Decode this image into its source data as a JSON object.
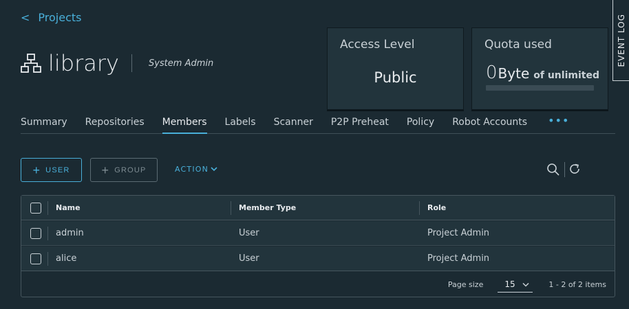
{
  "nav": {
    "back_arrow": "<",
    "back_label": "Projects"
  },
  "project": {
    "name": "library",
    "role": "System Admin",
    "icon": "project-tree-icon"
  },
  "cards": {
    "access": {
      "title": "Access Level",
      "value": "Public"
    },
    "quota": {
      "title": "Quota used",
      "value": "0",
      "unit": "Byte",
      "of_label": "of unlimited",
      "usage_fraction": 0
    }
  },
  "event_log": {
    "label": "EVENT LOG"
  },
  "tabs": [
    {
      "label": "Summary",
      "active": false
    },
    {
      "label": "Repositories",
      "active": false
    },
    {
      "label": "Members",
      "active": true
    },
    {
      "label": "Labels",
      "active": false
    },
    {
      "label": "Scanner",
      "active": false
    },
    {
      "label": "P2P Preheat",
      "active": false
    },
    {
      "label": "Policy",
      "active": false
    },
    {
      "label": "Robot Accounts",
      "active": false
    }
  ],
  "tabs_more": "•••",
  "toolbar": {
    "add_user": "USER",
    "add_group": "GROUP",
    "action": "ACTION",
    "search_icon": "search-icon",
    "refresh_icon": "refresh-icon"
  },
  "grid": {
    "columns": [
      "Name",
      "Member Type",
      "Role"
    ],
    "rows": [
      {
        "name": "admin",
        "type": "User",
        "role": "Project Admin"
      },
      {
        "name": "alice",
        "type": "User",
        "role": "Project Admin"
      }
    ],
    "footer": {
      "page_size_label": "Page size",
      "page_size_value": "15",
      "count_label": "1 - 2 of 2 items"
    }
  },
  "colors": {
    "background": "#1b2a32",
    "card": "#22343c",
    "accent": "#49afd9",
    "text": "#e9ecef"
  }
}
